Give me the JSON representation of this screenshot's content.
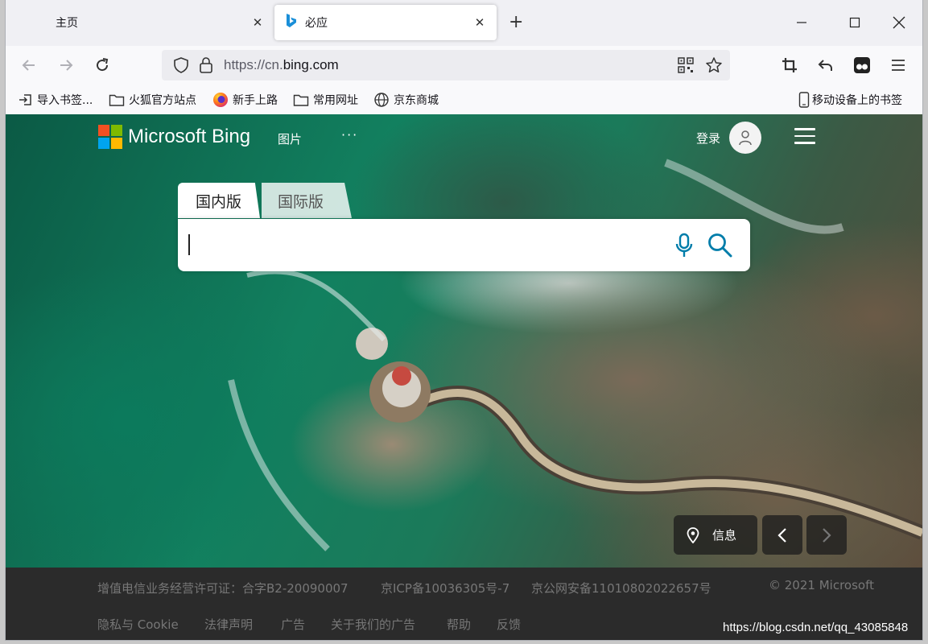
{
  "browser": {
    "tabs": [
      {
        "label": "主页",
        "active": false
      },
      {
        "label": "必应",
        "active": true
      }
    ],
    "url": {
      "scheme": "https://cn.",
      "domain": "bing.com"
    },
    "bookmarks": [
      {
        "label": "导入书签...",
        "icon": "import-icon"
      },
      {
        "label": "火狐官方站点",
        "icon": "folder-icon"
      },
      {
        "label": "新手上路",
        "icon": "firefox-icon"
      },
      {
        "label": "常用网址",
        "icon": "folder-icon"
      },
      {
        "label": "京东商城",
        "icon": "globe-icon"
      },
      {
        "label": "移动设备上的书签",
        "icon": "mobile-icon"
      }
    ]
  },
  "page": {
    "logo_text": "Microsoft Bing",
    "nav_images": "图片",
    "nav_more": "···",
    "login": "登录",
    "scope_tabs": [
      "国内版",
      "国际版"
    ],
    "search": {
      "value": "",
      "placeholder": ""
    },
    "info_label": "信息",
    "footer_row1": [
      "增值电信业务经营许可证：合字B2-20090007",
      "京ICP备10036305号-7",
      "京公网安备11010802022657号",
      "© 2021 Microsoft"
    ],
    "footer_row2": [
      "隐私与 Cookie",
      "法律声明",
      "广告",
      "关于我们的广告",
      "帮助",
      "反馈"
    ]
  },
  "watermark": "https://blog.csdn.net/qq_43085848",
  "colors": {
    "accent": "#007daa",
    "tabbar": "#f0f0f4",
    "footer": "#2b2b2b"
  }
}
